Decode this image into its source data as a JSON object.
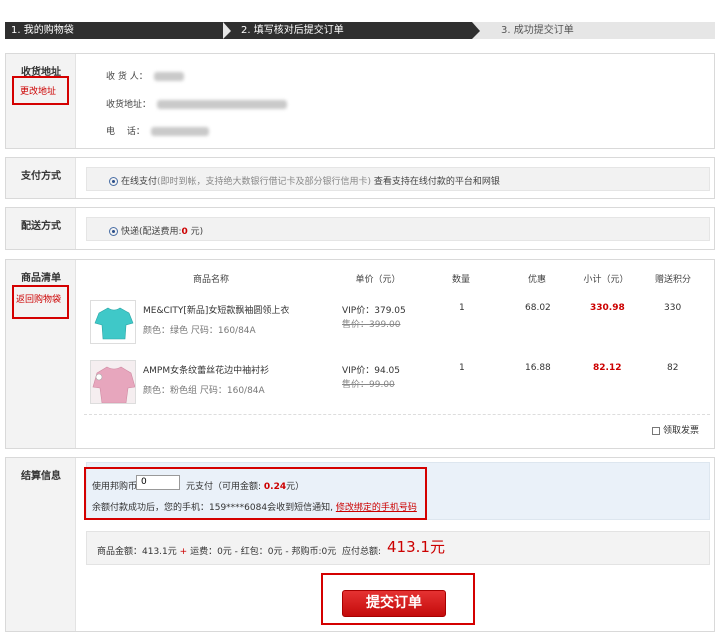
{
  "steps": [
    "1. 我的购物袋",
    "2. 填写核对后提交订单",
    "3. 成功提交订单"
  ],
  "address": {
    "title": "收货地址",
    "change_link": "更改地址",
    "recipient_label": "收 货 人：",
    "address_label": "收货地址：",
    "phone_label": "电　 话："
  },
  "payment": {
    "title": "支付方式",
    "option_name": "在线支付",
    "option_note": "(即时到帐，支持绝大数银行借记卡及部分银行信用卡)",
    "option_desc": "查看支持在线付款的平台和网银"
  },
  "delivery": {
    "title": "配送方式",
    "option_prefix": "快递(配送费用:",
    "fee": "0",
    "option_suffix": " 元)"
  },
  "products": {
    "title": "商品清单",
    "back_link": "返回购物袋",
    "headers": [
      "商品名称",
      "单价（元）",
      "数量",
      "优惠",
      "小计（元）",
      "赠送积分"
    ],
    "items": [
      {
        "name": "ME&CITY[新品]女短款飘袖圆领上衣",
        "attrs": "颜色：绿色 尺码：160/84A",
        "vip_price": "VIP价：379.05",
        "orig_price": "售价：399.00",
        "qty": "1",
        "discount": "68.02",
        "subtotal": "330.98",
        "points": "330",
        "image_color": "#3fc8c8"
      },
      {
        "name": "AMPM女条纹蕾丝花边中袖衬衫",
        "attrs": "颜色：粉色组 尺码：160/84A",
        "vip_price": "VIP价：94.05",
        "orig_price": "售价：99.00",
        "qty": "1",
        "discount": "16.88",
        "subtotal": "82.12",
        "points": "82",
        "image_color": "#e7a6bd"
      }
    ],
    "invoice_label": "领取发票"
  },
  "settlement": {
    "title": "结算信息",
    "coin_prefix": "使用邦购币",
    "coin_value": "0",
    "coin_suffix": "元支付（可用金额:",
    "coin_available": "0.24",
    "coin_end": "元）",
    "sms_text": "余额付款成功后，您的手机：159****6084会收到短信通知,",
    "sms_link": "修改绑定的手机号码",
    "summary_left": "商品金额：413.1元",
    "summary_plus": "+",
    "summary_mid": "运费：0元 - 红包：0元 - 邦购币:0元",
    "total_label": "应付总额:",
    "total_value": "413.1元",
    "submit_label": "提交订单"
  },
  "colors": {
    "accent_red": "#c00000",
    "step_dark": "#2f2f2f"
  }
}
